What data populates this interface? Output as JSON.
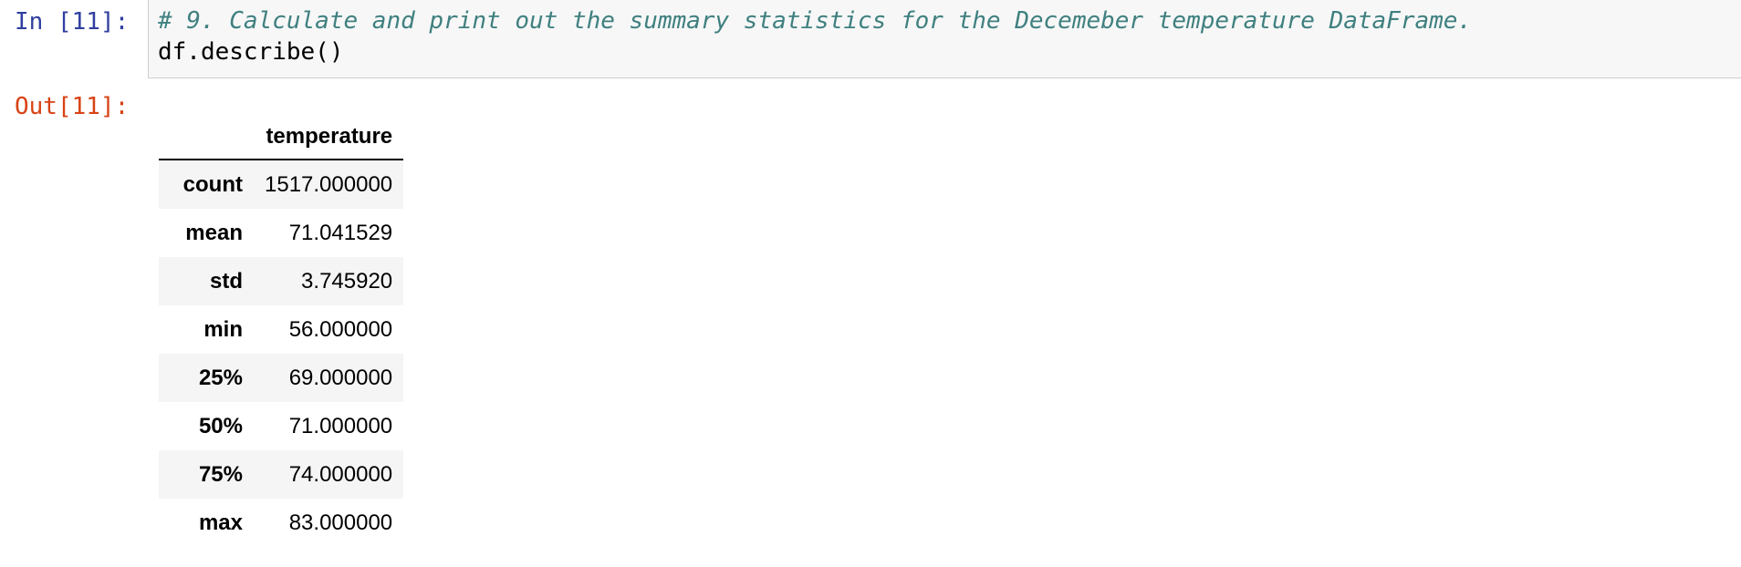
{
  "cell": {
    "in_prompt": "In [11]:",
    "out_prompt": "Out[11]:",
    "code": {
      "comment": "# 9. Calculate and print out the summary statistics for the Decemeber temperature DataFrame.",
      "line2": "df.describe()"
    }
  },
  "output": {
    "table": {
      "index_header": "",
      "columns": [
        "temperature"
      ],
      "rows": [
        {
          "index": "count",
          "value": "1517.000000"
        },
        {
          "index": "mean",
          "value": "71.041529"
        },
        {
          "index": "std",
          "value": "3.745920"
        },
        {
          "index": "min",
          "value": "56.000000"
        },
        {
          "index": "25%",
          "value": "69.000000"
        },
        {
          "index": "50%",
          "value": "71.000000"
        },
        {
          "index": "75%",
          "value": "74.000000"
        },
        {
          "index": "max",
          "value": "83.000000"
        }
      ]
    }
  },
  "colors": {
    "in_prompt": "#303f9f",
    "out_prompt": "#d84315",
    "comment": "#408080",
    "input_background": "#f7f7f7"
  }
}
